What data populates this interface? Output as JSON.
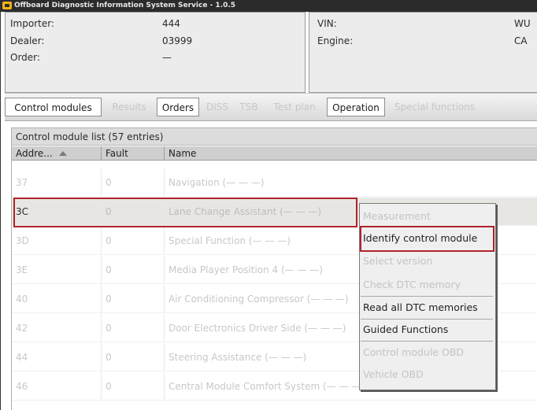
{
  "window": {
    "title": "Offboard Diagnostic Information System Service - 1.0.5"
  },
  "info_left": {
    "rows": [
      {
        "label": "Importer:",
        "value": "444"
      },
      {
        "label": "Dealer:",
        "value": "03999"
      },
      {
        "label": "Order:",
        "value": "—"
      }
    ]
  },
  "info_right": {
    "rows": [
      {
        "label": "VIN:",
        "value": "WU"
      },
      {
        "label": "Engine:",
        "value": "CA"
      }
    ]
  },
  "tabs": [
    {
      "label": "Control modules",
      "enabled": true
    },
    {
      "label": "Results",
      "enabled": false
    },
    {
      "label": "Orders",
      "enabled": true
    },
    {
      "label": "DISS",
      "enabled": false
    },
    {
      "label": "TSB",
      "enabled": false
    },
    {
      "label": "Test plan",
      "enabled": false
    },
    {
      "label": "Operation",
      "enabled": true
    },
    {
      "label": "Special functions",
      "enabled": false
    }
  ],
  "list": {
    "header": "Control module list (57 entries)",
    "columns": [
      "Addre...",
      "Fault",
      "Name"
    ],
    "sort_column": "Addre...",
    "rows": [
      {
        "address": "37",
        "fault": "0",
        "name": "Navigation (—  —  —)"
      },
      {
        "address": "3C",
        "fault": "0",
        "name": "Lane Change Assistant (—  —  —)"
      },
      {
        "address": "3D",
        "fault": "0",
        "name": "Special Function (—  —  —)"
      },
      {
        "address": "3E",
        "fault": "0",
        "name": "Media Player Position 4 (—  —  —)"
      },
      {
        "address": "40",
        "fault": "0",
        "name": "Air Conditioning Compressor (—  —  —)"
      },
      {
        "address": "42",
        "fault": "0",
        "name": "Door Electronics Driver Side (—  —  —)"
      },
      {
        "address": "44",
        "fault": "0",
        "name": "Steering Assistance (—  —  —)"
      },
      {
        "address": "46",
        "fault": "0",
        "name": "Central Module Comfort System (—  —  —)"
      }
    ],
    "selected_address": "3C"
  },
  "context_menu": {
    "items": [
      {
        "label": "Measurement",
        "enabled": false
      },
      {
        "label": "Identify control module",
        "enabled": true
      },
      {
        "label": "Select version",
        "enabled": false
      },
      {
        "label": "Check DTC memory",
        "enabled": false
      },
      {
        "label": "Read all DTC memories",
        "enabled": true
      },
      {
        "label": "Guided Functions",
        "enabled": true
      },
      {
        "label": "Control module OBD",
        "enabled": false
      },
      {
        "label": "Vehicle OBD",
        "enabled": false
      }
    ],
    "highlighted": "Identify control module"
  },
  "colors": {
    "highlight_border": "#b0232b",
    "disabled_text": "#c3c3c3",
    "title_bar": "#2b2b2b"
  }
}
